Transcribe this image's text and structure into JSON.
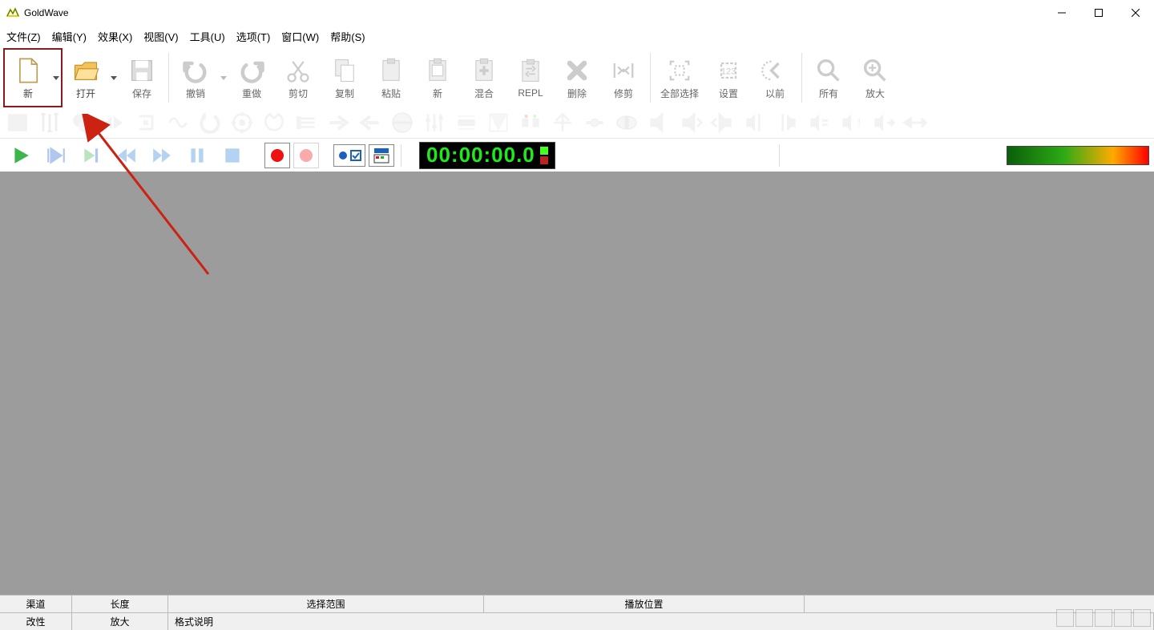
{
  "app": {
    "title": "GoldWave"
  },
  "menubar": [
    "文件(Z)",
    "编辑(Y)",
    "效果(X)",
    "视图(V)",
    "工具(U)",
    "选项(T)",
    "窗口(W)",
    "帮助(S)"
  ],
  "toolbar": {
    "new": "新",
    "open": "打开",
    "save": "保存",
    "undo": "撤销",
    "redo": "重做",
    "cut": "剪切",
    "copy": "复制",
    "paste": "粘贴",
    "new2": "新",
    "mix": "混合",
    "repl": "REPL",
    "delete": "删除",
    "trim": "修剪",
    "selectall": "全部选择",
    "set": "设置",
    "prev": "以前",
    "all": "所有",
    "zoomin": "放大"
  },
  "transport": {
    "time": "00:00:00.0"
  },
  "status": {
    "r1": [
      "渠道",
      "长度",
      "选择范围",
      "播放位置",
      ""
    ],
    "r2": [
      "改性",
      "放大",
      "格式说明"
    ]
  }
}
